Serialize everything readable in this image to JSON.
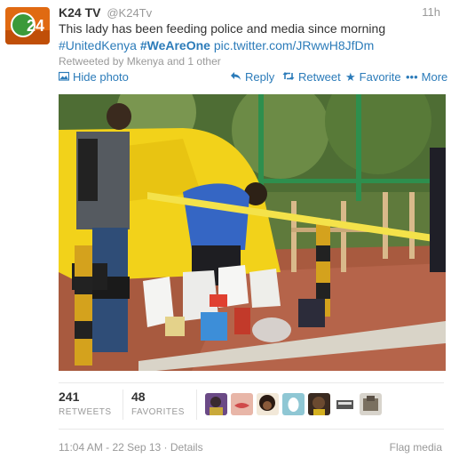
{
  "tweet": {
    "author_name": "K24 TV",
    "author_handle": "@K24Tv",
    "time_ago": "11h",
    "text_plain": "This lady has been feeding police and media since morning",
    "hashtag1": "#UnitedKenya",
    "hashtag2": "#WeAreOne",
    "link": "pic.twitter.com/JRwwH8JfDm",
    "retweeted_by": "Retweeted by Mkenya and 1 other",
    "avatar_logo": "24"
  },
  "actions": {
    "hide_photo": "Hide photo",
    "reply": "Reply",
    "retweet": "Retweet",
    "favorite": "Favorite",
    "more": "More"
  },
  "icons": {
    "photo": "photo-icon",
    "reply": "reply-arrow-icon",
    "retweet": "retweet-icon",
    "favorite": "star-icon",
    "more": "ellipsis-icon"
  },
  "stats": {
    "retweets_count": "241",
    "retweets_label": "RETWEETS",
    "favorites_count": "48",
    "favorites_label": "FAVORITES"
  },
  "footer": {
    "timestamp": "11:04 AM - 22 Sep 13",
    "details": "Details",
    "separator": "·",
    "flag_media": "Flag media"
  },
  "colors": {
    "link": "#2b7bb9",
    "muted": "#999999",
    "text": "#333333",
    "tent_yellow": "#f2d21a"
  }
}
